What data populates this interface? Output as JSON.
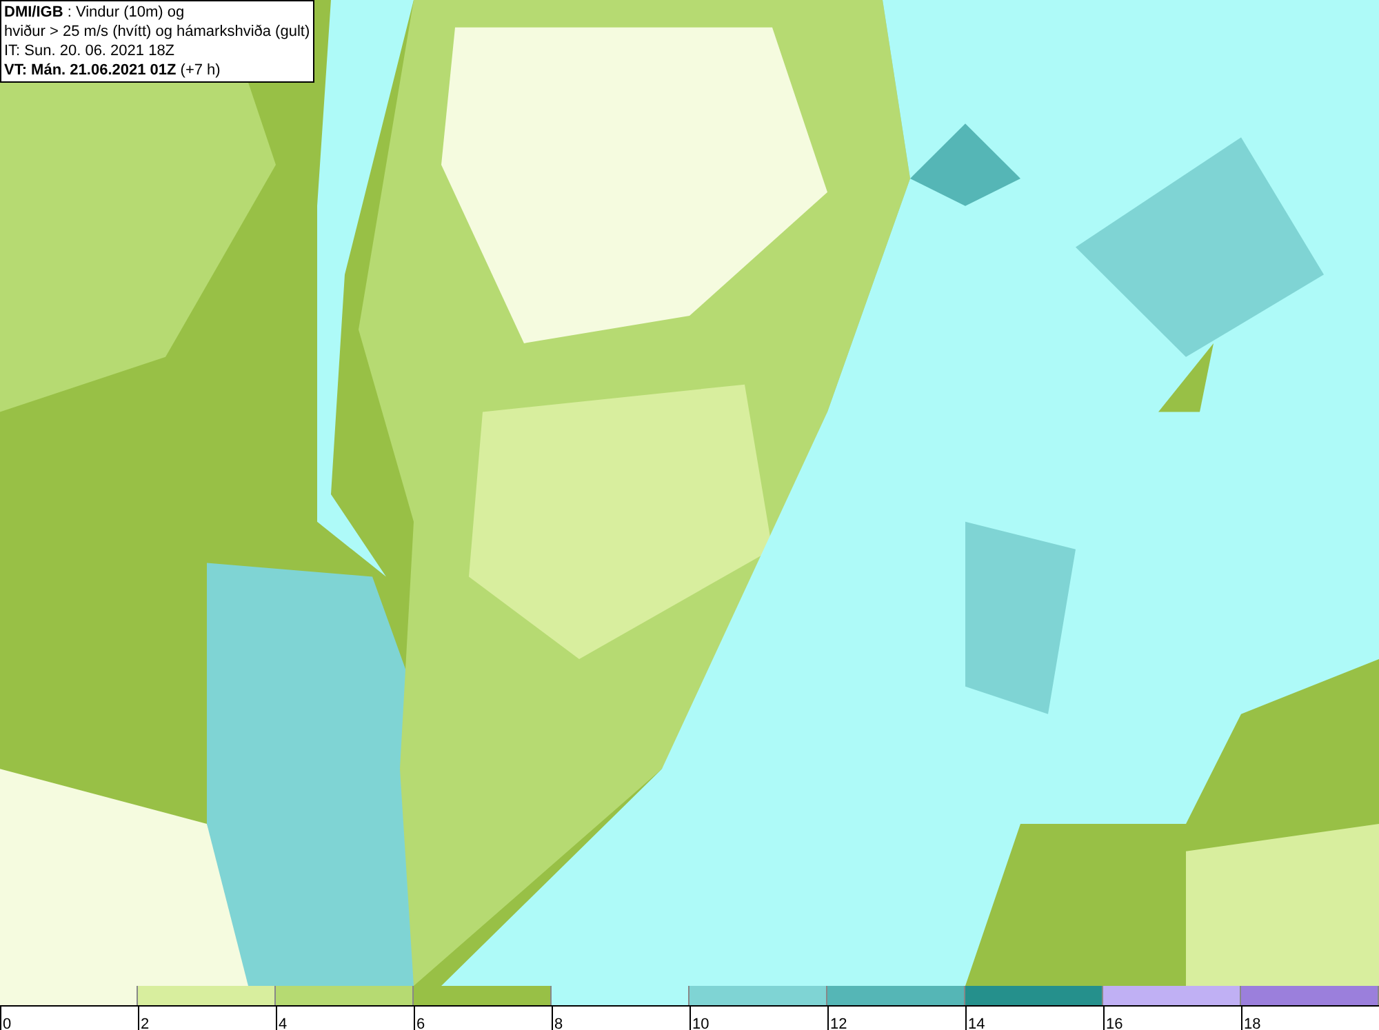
{
  "title_box": {
    "lines": [
      "**DMI/IGB** : Vindur (10m) og",
      "hviður > 25 m/s (hvítt) og hámarkshviða (gult)",
      "IT: Sun. 20. 06. 2021 18Z",
      "**VT: Mán. 21.06.2021 01Z** (+7 h)"
    ]
  },
  "legend": {
    "segments": [
      {
        "color": "#f5fbdf"
      },
      {
        "color": "#d8ee9e"
      },
      {
        "color": "#b6da72"
      },
      {
        "color": "#98c046"
      },
      {
        "color": "#aefaf8"
      },
      {
        "color": "#7fd4d4"
      },
      {
        "color": "#55b6b6"
      },
      {
        "color": "#25908c"
      },
      {
        "color": "#c0b0f4"
      },
      {
        "color": "#9b7fdc"
      }
    ],
    "ticks": [
      "0",
      "2",
      "4",
      "6",
      "8",
      "10",
      "12",
      "14",
      "16",
      "18"
    ]
  }
}
